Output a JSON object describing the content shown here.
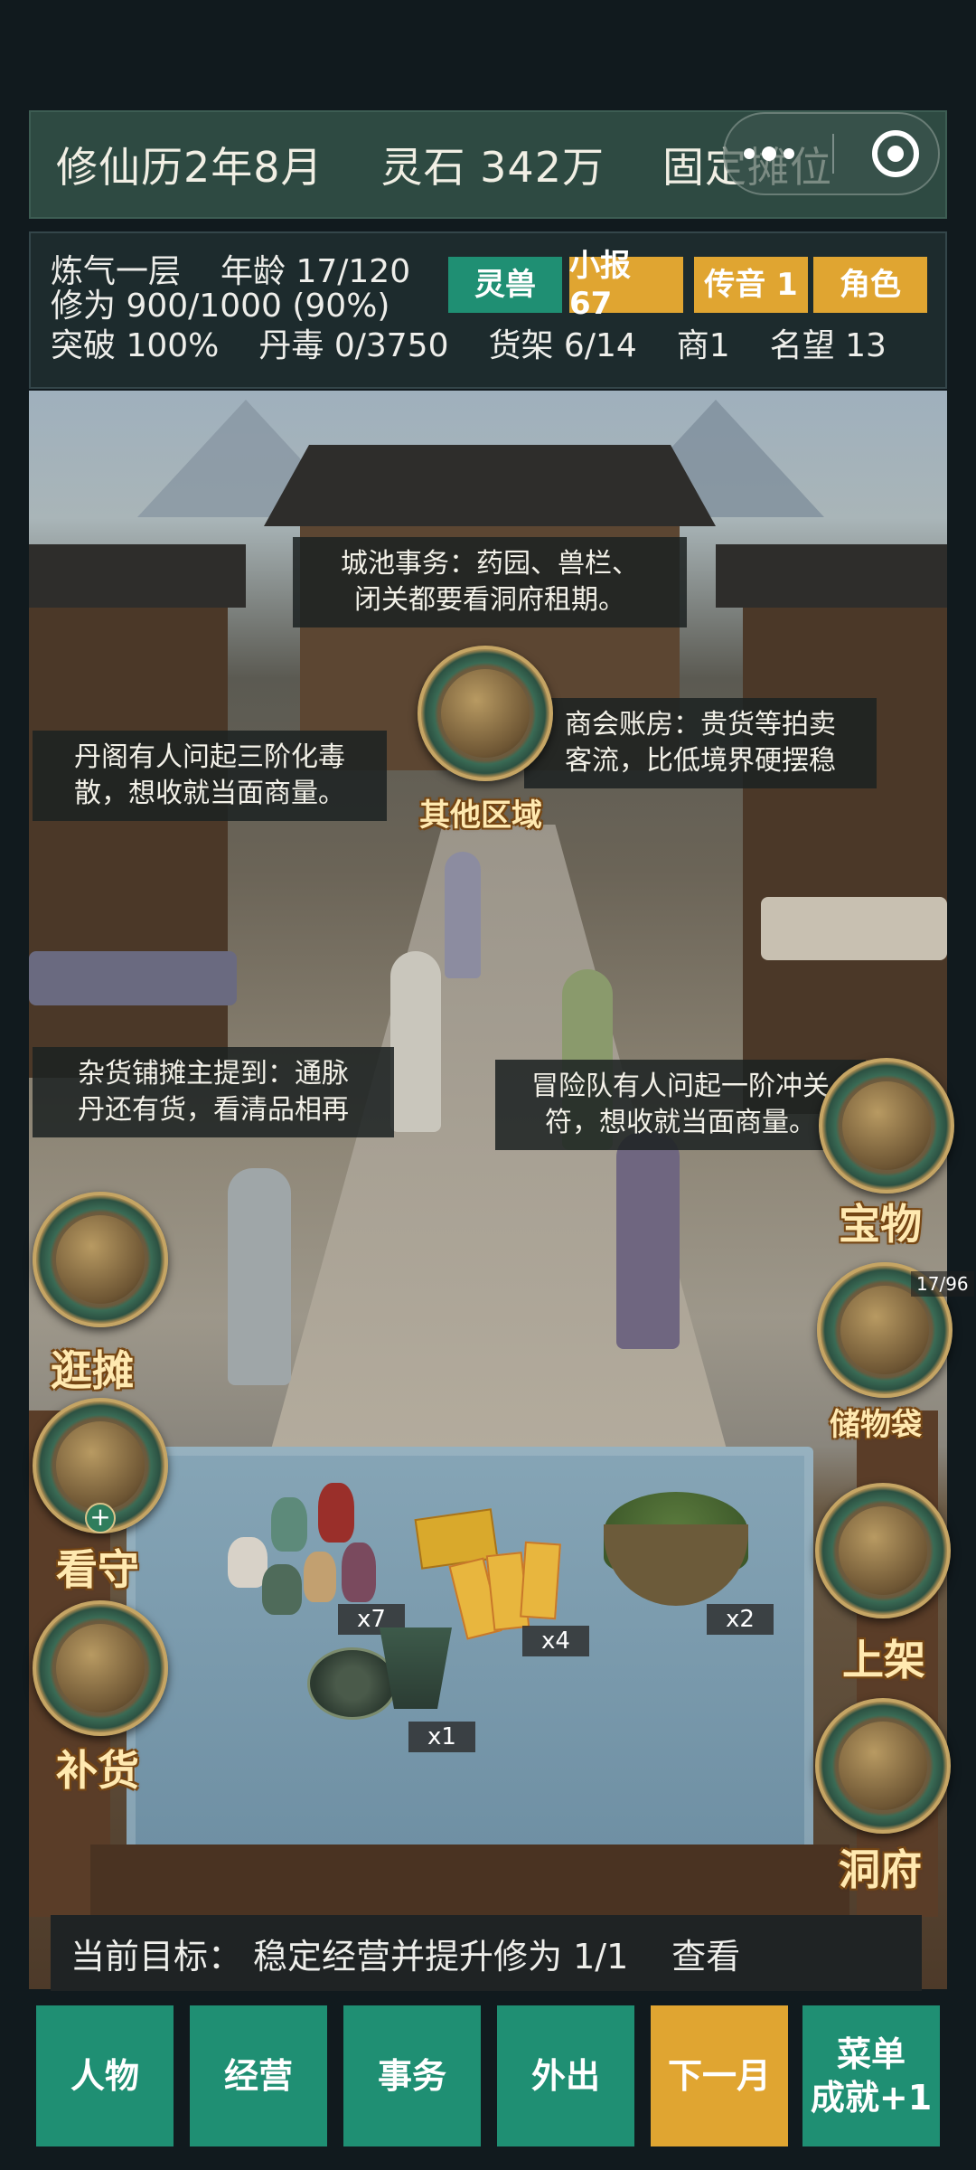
{
  "top_bar": {
    "calendar": "修仙历2年8月",
    "spirit_stones": "灵石 342万",
    "stall": "固定摊位"
  },
  "stats": {
    "realm": "炼气一层",
    "age": "年龄 17/120",
    "cultivation": "修为 900/1000 (90%)",
    "breakthrough": "突破 100%",
    "poison": "丹毒 0/3750",
    "shelves": "货架 6/14",
    "merchant": "商1",
    "reputation": "名望 13"
  },
  "tags": {
    "beast": "灵兽",
    "news": "小报 67",
    "message": "传音 1",
    "role": "角色"
  },
  "tips": {
    "city": "城池事务：药园、兽栏、闭关都要看洞府租期。",
    "city_l1": "城池事务：药园、兽栏、",
    "city_l2": "闭关都要看洞府租期。",
    "danju_l1": "丹阁有人问起三阶化毒",
    "danju_l2": "散，想收就当面商量。",
    "guild_l1": "商会账房：贵货等拍卖",
    "guild_l2": "客流，比低境界硬摆稳",
    "grocery_l1": "杂货铺摊主提到：通脉",
    "grocery_l2": "丹还有货，看清品相再",
    "team_l1": "冒险队有人问起一阶冲关",
    "team_l2": "符，想收就当面商量。"
  },
  "round_buttons": {
    "other_areas": "其他区域",
    "treasure": "宝物",
    "bag": "储物袋",
    "bag_count": "17/96",
    "browse": "逛摊",
    "guard": "看守",
    "guard_plus": "+",
    "shelve": "上架",
    "restock": "补货",
    "cave": "洞府"
  },
  "stall_items": {
    "pills_count": "x7",
    "talisman_count": "x4",
    "herbs_count": "x2",
    "banner_count": "x1"
  },
  "goal": {
    "label": "当前目标：",
    "text": "稳定经营并提升修为 1/1",
    "view": "查看"
  },
  "nav": {
    "character": "人物",
    "business": "经营",
    "affairs": "事务",
    "outing": "外出",
    "next_month": "下一月",
    "menu_l1": "菜单",
    "menu_l2": "成就+1"
  },
  "colors": {
    "accent_green": "#1f8f73",
    "accent_gold": "#e0a531",
    "panel": "#2e4a42"
  }
}
